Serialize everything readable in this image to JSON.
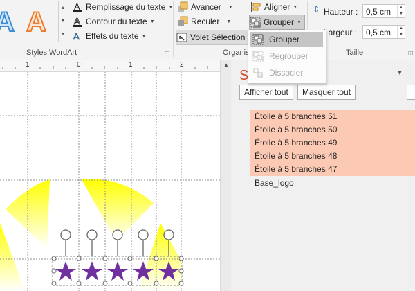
{
  "ribbon": {
    "wordart_group_label": "Styles WordArt",
    "arrange_group_label": "Organis",
    "size_group_label": "Taille",
    "text_fill": "Remplissage du texte",
    "text_outline": "Contour du texte",
    "text_effects": "Effets du texte",
    "bring_forward": "Avancer",
    "send_backward": "Reculer",
    "selection_pane": "Volet Sélection",
    "align": "Aligner",
    "group": "Grouper",
    "height_label": "Hauteur :",
    "height_value": "0,5 cm",
    "width_label": "Largeur :",
    "width_value": "0,5 cm",
    "wordart_sample": "A"
  },
  "group_menu": {
    "items": [
      {
        "label": "Grouper",
        "state": "hover"
      },
      {
        "label": "Regrouper",
        "state": "disabled"
      },
      {
        "label": "Dissocier",
        "state": "disabled"
      }
    ]
  },
  "ruler": {
    "ticks": [
      "1",
      "0",
      "1",
      "2"
    ]
  },
  "selection_pane": {
    "title_partial": "Se",
    "show_all": "Afficher tout",
    "hide_all": "Masquer tout",
    "objects": [
      {
        "name": "Étoile à 5 branches 51",
        "selected": true
      },
      {
        "name": "Étoile à 5 branches 50",
        "selected": true
      },
      {
        "name": "Étoile à 5 branches 49",
        "selected": true
      },
      {
        "name": "Étoile à 5 branches 48",
        "selected": true
      },
      {
        "name": "Étoile à 5 branches 47",
        "selected": true
      },
      {
        "name": "Base_logo",
        "selected": false
      }
    ]
  },
  "colors": {
    "accent_red": "#d24726",
    "selected_row": "#fccab4",
    "star_purple": "#7030a0",
    "logo_yellow": "#ffff00",
    "wordart_blue": "#3b8fd6",
    "wordart_orange": "#ed7d31"
  }
}
